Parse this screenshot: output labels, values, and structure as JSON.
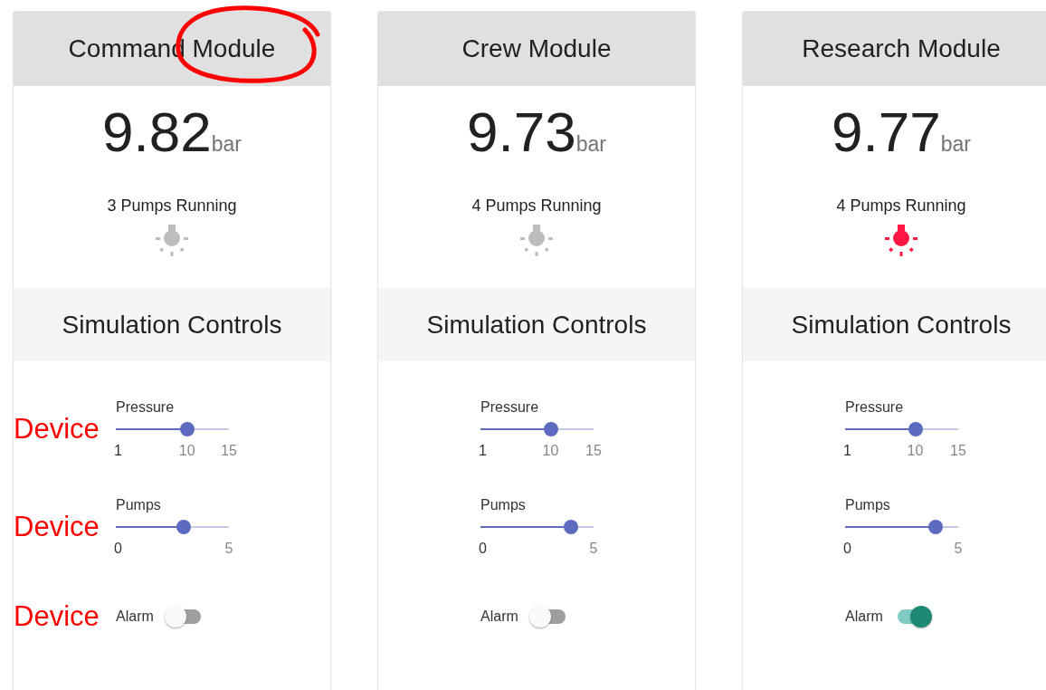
{
  "modules": [
    {
      "title": "Command Module",
      "title_circled": true,
      "value": "9.82",
      "unit": "bar",
      "pumps_text": "3 Pumps Running",
      "light_on": false,
      "controls_title": "Simulation Controls",
      "controls": [
        {
          "kind": "slider",
          "label": "Pressure",
          "level": 0.63,
          "ticks": [
            "1",
            "10",
            "15"
          ],
          "annotation": "Device"
        },
        {
          "kind": "slider",
          "label": "Pumps",
          "level": 0.6,
          "ticks": [
            "0",
            "5"
          ],
          "annotation": "Device"
        },
        {
          "kind": "switch",
          "label": "Alarm",
          "on": false,
          "annotation": "Device"
        }
      ]
    },
    {
      "title": "Crew Module",
      "title_circled": false,
      "value": "9.73",
      "unit": "bar",
      "pumps_text": "4 Pumps Running",
      "light_on": false,
      "controls_title": "Simulation Controls",
      "controls": [
        {
          "kind": "slider",
          "label": "Pressure",
          "level": 0.62,
          "ticks": [
            "1",
            "10",
            "15"
          ]
        },
        {
          "kind": "slider",
          "label": "Pumps",
          "level": 0.8,
          "ticks": [
            "0",
            "5"
          ]
        },
        {
          "kind": "switch",
          "label": "Alarm",
          "on": false
        }
      ]
    },
    {
      "title": "Research Module",
      "title_circled": false,
      "value": "9.77",
      "unit": "bar",
      "pumps_text": "4 Pumps Running",
      "light_on": true,
      "controls_title": "Simulation Controls",
      "controls": [
        {
          "kind": "slider",
          "label": "Pressure",
          "level": 0.62,
          "ticks": [
            "1",
            "10",
            "15"
          ]
        },
        {
          "kind": "slider",
          "label": "Pumps",
          "level": 0.8,
          "ticks": [
            "0",
            "5"
          ]
        },
        {
          "kind": "switch",
          "label": "Alarm",
          "on": true
        }
      ]
    }
  ]
}
